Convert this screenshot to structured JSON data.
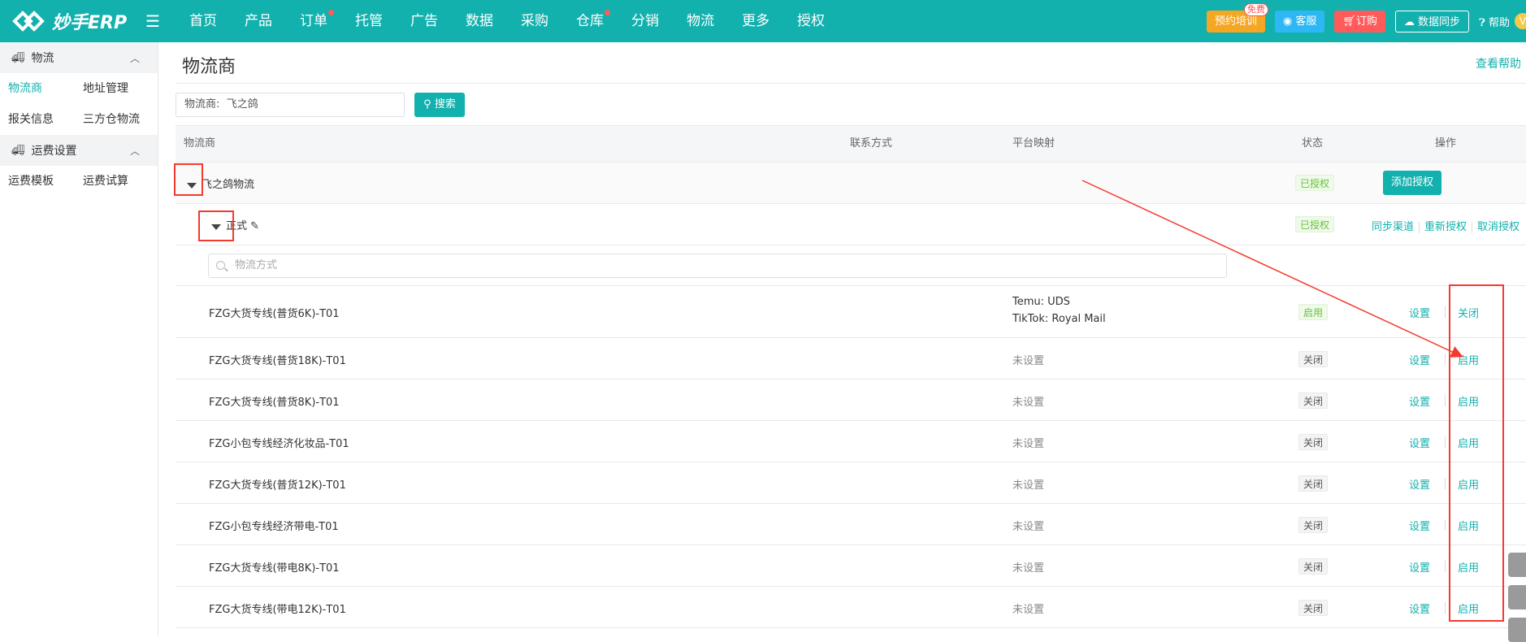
{
  "brand": {
    "name": "妙手ERP"
  },
  "nav": {
    "items": [
      {
        "label": "首页",
        "dot": false
      },
      {
        "label": "产品",
        "dot": false
      },
      {
        "label": "订单",
        "dot": true
      },
      {
        "label": "托管",
        "dot": false
      },
      {
        "label": "广告",
        "dot": false
      },
      {
        "label": "数据",
        "dot": false
      },
      {
        "label": "采购",
        "dot": false
      },
      {
        "label": "仓库",
        "dot": true
      },
      {
        "label": "分销",
        "dot": false
      },
      {
        "label": "物流",
        "dot": false
      },
      {
        "label": "更多",
        "dot": false
      },
      {
        "label": "授权",
        "dot": false
      }
    ]
  },
  "topright": {
    "training": "预约培训",
    "free_badge": "免费",
    "service": "客服",
    "order": "订购",
    "sync": "数据同步",
    "help": "帮助",
    "vip": "V"
  },
  "sidebar": {
    "groups": [
      {
        "title": "物流",
        "items": [
          "物流商",
          "地址管理",
          "报关信息",
          "三方仓物流"
        ]
      },
      {
        "title": "运费设置",
        "items": [
          "运费模板",
          "运费试算"
        ]
      }
    ]
  },
  "page": {
    "title": "物流商",
    "help_link": "查看帮助",
    "filter_label": "物流商:",
    "filter_value": "飞之鸽",
    "search_button": "搜索"
  },
  "table": {
    "headers": {
      "carrier": "物流商",
      "contact": "联系方式",
      "mapping": "平台映射",
      "status": "状态",
      "action": "操作"
    },
    "carrier": {
      "name": "飞之鸽物流",
      "status": "已授权",
      "action": "添加授权"
    },
    "account": {
      "name": "正式",
      "status": "已授权",
      "actions": [
        "同步渠道",
        "重新授权",
        "取消授权"
      ]
    },
    "mode_search_placeholder": "物流方式",
    "rows": [
      {
        "name": "FZG大货专线(普货6K)-T01",
        "mapping": [
          "Temu:  UDS",
          "TikTok:  Royal Mail"
        ],
        "status": "启用",
        "enabled": true,
        "set": "设置",
        "toggle": "关闭"
      },
      {
        "name": "FZG大货专线(普货18K)-T01",
        "mapping": [
          "未设置"
        ],
        "status": "关闭",
        "enabled": false,
        "set": "设置",
        "toggle": "启用"
      },
      {
        "name": "FZG大货专线(普货8K)-T01",
        "mapping": [
          "未设置"
        ],
        "status": "关闭",
        "enabled": false,
        "set": "设置",
        "toggle": "启用"
      },
      {
        "name": "FZG小包专线经济化妆品-T01",
        "mapping": [
          "未设置"
        ],
        "status": "关闭",
        "enabled": false,
        "set": "设置",
        "toggle": "启用"
      },
      {
        "name": "FZG大货专线(普货12K)-T01",
        "mapping": [
          "未设置"
        ],
        "status": "关闭",
        "enabled": false,
        "set": "设置",
        "toggle": "启用"
      },
      {
        "name": "FZG小包专线经济带电-T01",
        "mapping": [
          "未设置"
        ],
        "status": "关闭",
        "enabled": false,
        "set": "设置",
        "toggle": "启用"
      },
      {
        "name": "FZG大货专线(带电8K)-T01",
        "mapping": [
          "未设置"
        ],
        "status": "关闭",
        "enabled": false,
        "set": "设置",
        "toggle": "启用"
      },
      {
        "name": "FZG大货专线(带电12K)-T01",
        "mapping": [
          "未设置"
        ],
        "status": "关闭",
        "enabled": false,
        "set": "设置",
        "toggle": "启用"
      }
    ]
  },
  "colors": {
    "brand": "#13b1ae",
    "annotation": "#f43a2e"
  }
}
